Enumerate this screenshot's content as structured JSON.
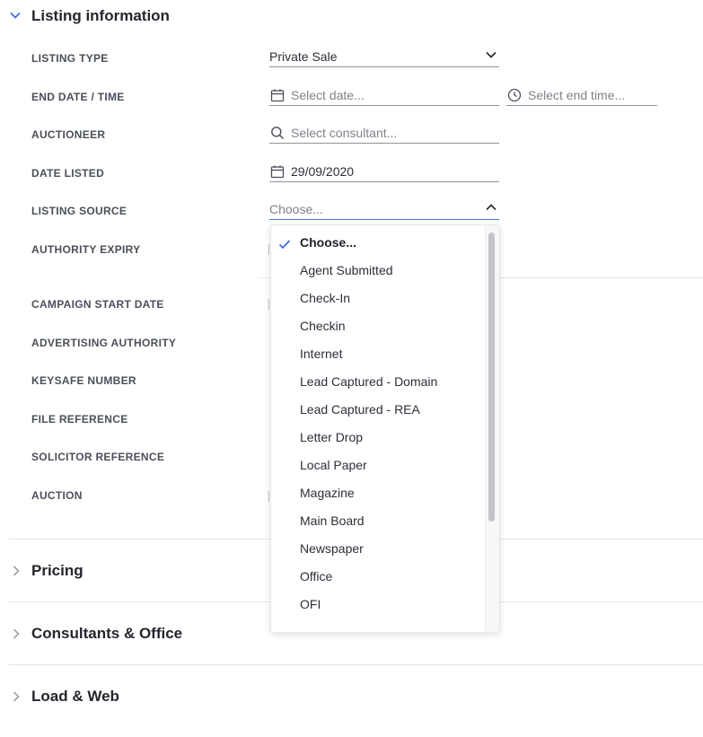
{
  "sections": {
    "listing_information": "Listing information",
    "pricing": "Pricing",
    "consultants_office": "Consultants & Office",
    "load_web": "Load & Web"
  },
  "labels": {
    "listing_type": "LISTING TYPE",
    "end_date_time": "END DATE / TIME",
    "auctioneer": "AUCTIONEER",
    "date_listed": "DATE LISTED",
    "listing_source": "LISTING SOURCE",
    "authority_expiry": "AUTHORITY EXPIRY",
    "campaign_start_date": "CAMPAIGN START DATE",
    "advertising_authority": "ADVERTISING AUTHORITY",
    "keysafe_number": "KEYSAFE NUMBER",
    "file_reference": "FILE REFERENCE",
    "solicitor_reference": "SOLICITOR REFERENCE",
    "auction": "AUCTION"
  },
  "fields": {
    "listing_type_value": "Private Sale",
    "end_date_placeholder": "Select date...",
    "end_time_placeholder": "Select end time...",
    "auctioneer_placeholder": "Select consultant...",
    "date_listed_value": "29/09/2020",
    "listing_source_value": "Choose..."
  },
  "dropdown": {
    "selected": "Choose...",
    "options": [
      "Choose...",
      "Agent Submitted",
      "Check-In",
      "Checkin",
      "Internet",
      "Lead Captured - Domain",
      "Lead Captured - REA",
      "Letter Drop",
      "Local Paper",
      "Magazine",
      "Main Board",
      "Newspaper",
      "Office",
      "OFI"
    ]
  },
  "colors": {
    "accent": "#3b6fd6",
    "text": "#2b2f38",
    "placeholder": "#7e838b"
  }
}
